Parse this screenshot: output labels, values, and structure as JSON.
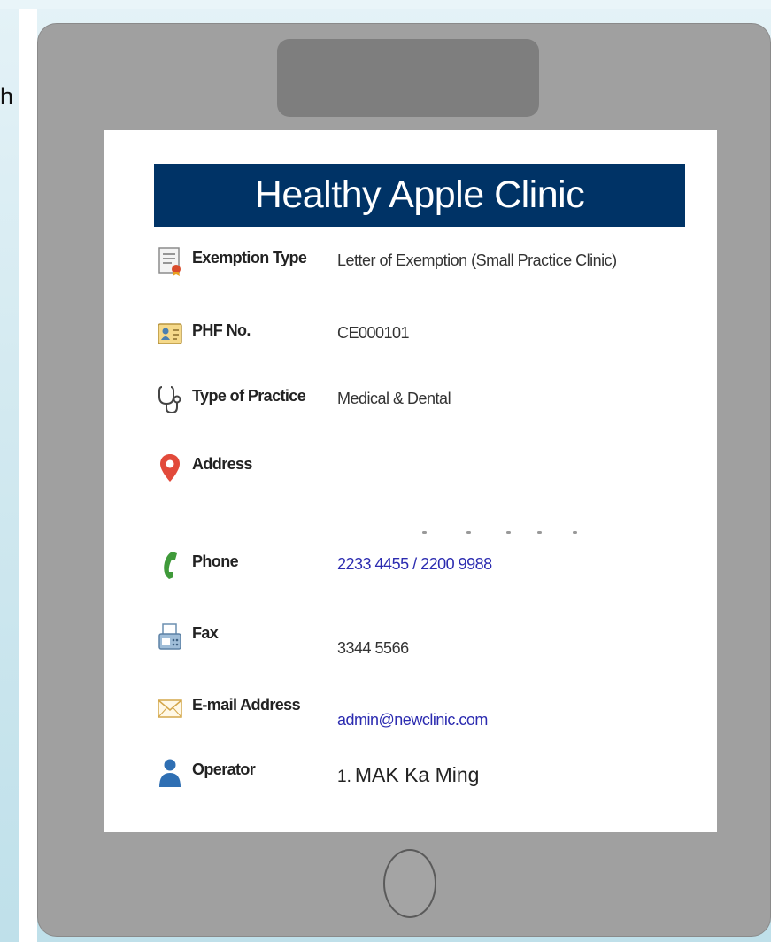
{
  "edge_text": "h",
  "clinic": {
    "name": "Healthy Apple Clinic"
  },
  "fields": {
    "exemption_type": {
      "label": "Exemption Type",
      "value": "Letter of Exemption (Small Practice Clinic)",
      "icon": "certificate-document-icon"
    },
    "phf_no": {
      "label": "PHF No.",
      "value": "CE000101",
      "icon": "id-card-icon"
    },
    "practice_type": {
      "label": "Type of Practice",
      "value": "Medical & Dental",
      "icon": "stethoscope-icon"
    },
    "address": {
      "label": "Address",
      "value": "",
      "icon": "map-pin-icon"
    },
    "phone": {
      "label": "Phone",
      "value": "2233 4455 / 2200 9988",
      "icon": "phone-handset-icon"
    },
    "fax": {
      "label": "Fax",
      "value": "3344 5566",
      "icon": "fax-machine-icon"
    },
    "email": {
      "label": "E-mail Address",
      "value": "admin@newclinic.com",
      "icon": "envelope-icon"
    },
    "operator": {
      "label": "Operator",
      "index": "1.",
      "value": "MAK Ka Ming",
      "icon": "person-icon"
    }
  },
  "colors": {
    "header_bg": "#003366",
    "link": "#2b2bb0",
    "pin_red": "#e24a3b",
    "phone_green": "#3f9a3a",
    "person_blue": "#2f6fb3",
    "tablet_frame": "#a0a0a0"
  }
}
